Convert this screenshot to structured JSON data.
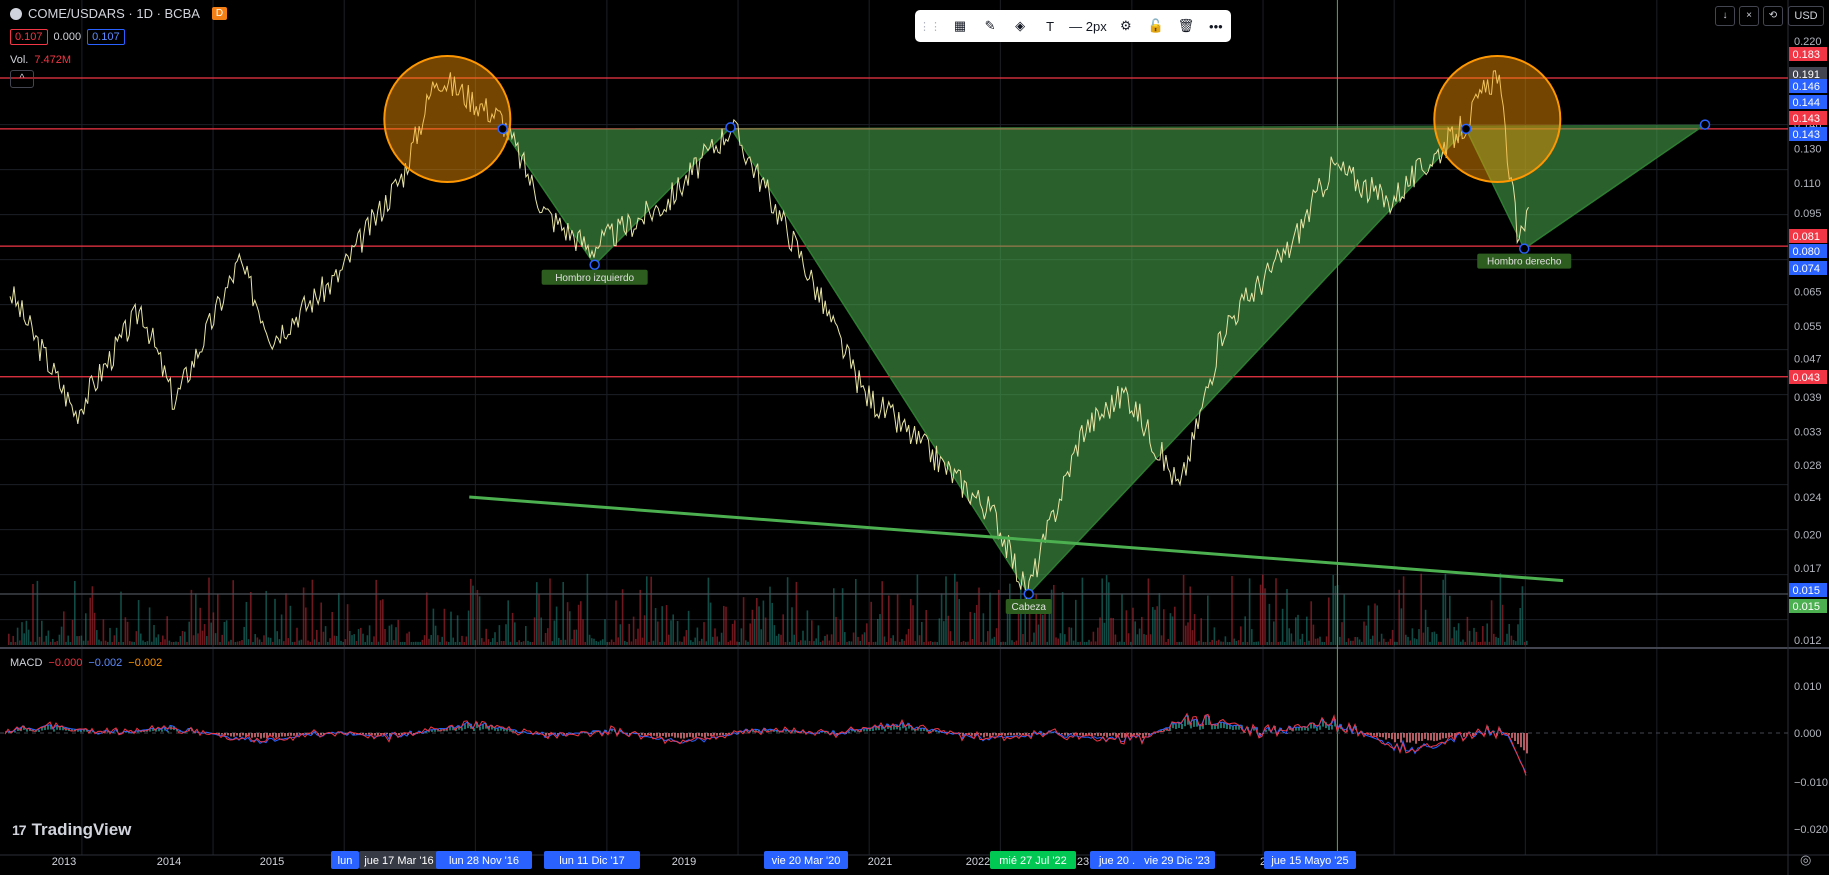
{
  "header": {
    "symbol": "COME/USDARS · 1D · BCBA",
    "badge": "D",
    "open_value": "0.107",
    "change_value": "0.000",
    "close_value": "0.107",
    "volume_label": "Vol.",
    "volume_value": "7.472M",
    "collapse_glyph": "^"
  },
  "toolbar": {
    "items": [
      {
        "name": "drag-handle-icon",
        "glyph": "⋮⋮"
      },
      {
        "name": "template-icon",
        "glyph": "▦"
      },
      {
        "name": "line-color-icon",
        "glyph": "✎"
      },
      {
        "name": "fill-color-icon",
        "glyph": "◈"
      },
      {
        "name": "text-icon",
        "glyph": "T"
      },
      {
        "name": "line-width-icon",
        "glyph": "— 2px"
      },
      {
        "name": "settings-icon",
        "glyph": "⚙"
      },
      {
        "name": "lock-icon",
        "glyph": "🔓"
      },
      {
        "name": "delete-icon",
        "glyph": "🗑"
      },
      {
        "name": "more-icon",
        "glyph": "•••"
      }
    ]
  },
  "top_right": {
    "buttons": [
      "↓",
      "×",
      "⟲"
    ],
    "currency": "USD"
  },
  "macd": {
    "label": "MACD",
    "v1": "−0.000",
    "v2": "−0.002",
    "v3": "−0.002",
    "axis_ticks": [
      "0.010",
      "0.000",
      "−0.010",
      "−0.020"
    ]
  },
  "brand": {
    "logo": "TradingView",
    "mark": "17"
  },
  "chart_data": {
    "type": "line",
    "price_axis_ticks": [
      "0.220",
      "0.146",
      "0.130",
      "0.110",
      "0.095",
      "0.065",
      "0.055",
      "0.047",
      "0.039",
      "0.033",
      "0.028",
      "0.024",
      "0.020",
      "0.017",
      "0.012"
    ],
    "price_tags": [
      {
        "text": "0.183",
        "color": "#f23645"
      },
      {
        "text": "0.191",
        "color": "#434651"
      },
      {
        "text": "0.146",
        "color": "#2962ff"
      },
      {
        "text": "0.144",
        "color": "#2962ff"
      },
      {
        "text": "0.143",
        "color": "#f23645"
      },
      {
        "text": "0.143",
        "color": "#2962ff"
      },
      {
        "text": "0.081",
        "color": "#f23645"
      },
      {
        "text": "0.080",
        "color": "#2962ff"
      },
      {
        "text": "0.074",
        "color": "#2962ff"
      },
      {
        "text": "0.043",
        "color": "#f23645"
      },
      {
        "text": "0.015",
        "color": "#2962ff"
      },
      {
        "text": "0.015",
        "color": "#4caf50"
      }
    ],
    "horizontal_levels": [
      0.183,
      0.143,
      0.081,
      0.043,
      0.015
    ],
    "time_axis_labels": [
      "2013",
      "2014",
      "2015",
      "2019",
      "2021",
      "2022",
      "23",
      "2"
    ],
    "date_tags": [
      {
        "text": "lun",
        "color": "#2962ff"
      },
      {
        "text": "jue 17 Mar '16",
        "color": "#363a45"
      },
      {
        "text": "lun 28 Nov '16",
        "color": "#2962ff"
      },
      {
        "text": "lun 11 Dic '17",
        "color": "#2962ff"
      },
      {
        "text": "vie 20 Mar '20",
        "color": "#2962ff"
      },
      {
        "text": "mié 27 Jul '22",
        "color": "#00c853"
      },
      {
        "text": "jue 20 .",
        "color": "#2962ff"
      },
      {
        "text": "vie 29 Dic '23",
        "color": "#2962ff"
      },
      {
        "text": "jue 15 Mayo '25",
        "color": "#2962ff"
      }
    ],
    "pattern_labels": [
      "Hombro izquierdo",
      "Cabeza",
      "Hombro derecho"
    ],
    "pattern_points": [
      {
        "date": "2016-03-17",
        "value": 0.143
      },
      {
        "date": "2016-11-28",
        "value": 0.074
      },
      {
        "date": "2017-12-11",
        "value": 0.144
      },
      {
        "date": "2020-03-20",
        "value": 0.015
      },
      {
        "date": "2023-07-20",
        "value": 0.143
      },
      {
        "date": "2023-12-29",
        "value": 0.08
      },
      {
        "date": "2025-05-15",
        "value": 0.146
      }
    ],
    "price_series_approx": [
      {
        "x": "2012-06",
        "y": 0.065
      },
      {
        "x": "2012-12",
        "y": 0.036
      },
      {
        "x": "2013-06",
        "y": 0.06
      },
      {
        "x": "2013-09",
        "y": 0.038
      },
      {
        "x": "2014-03",
        "y": 0.075
      },
      {
        "x": "2014-06",
        "y": 0.052
      },
      {
        "x": "2014-12",
        "y": 0.07
      },
      {
        "x": "2015-06",
        "y": 0.115
      },
      {
        "x": "2015-09",
        "y": 0.185
      },
      {
        "x": "2016-03",
        "y": 0.15
      },
      {
        "x": "2016-07",
        "y": 0.095
      },
      {
        "x": "2016-11",
        "y": 0.08
      },
      {
        "x": "2017-06",
        "y": 0.1
      },
      {
        "x": "2017-12",
        "y": 0.145
      },
      {
        "x": "2018-06",
        "y": 0.08
      },
      {
        "x": "2018-12",
        "y": 0.04
      },
      {
        "x": "2019-06",
        "y": 0.03
      },
      {
        "x": "2019-12",
        "y": 0.022
      },
      {
        "x": "2020-03",
        "y": 0.015
      },
      {
        "x": "2020-08",
        "y": 0.033
      },
      {
        "x": "2020-12",
        "y": 0.04
      },
      {
        "x": "2021-05",
        "y": 0.025
      },
      {
        "x": "2021-09",
        "y": 0.055
      },
      {
        "x": "2022-03",
        "y": 0.08
      },
      {
        "x": "2022-07",
        "y": 0.12
      },
      {
        "x": "2022-12",
        "y": 0.1
      },
      {
        "x": "2023-07",
        "y": 0.145
      },
      {
        "x": "2023-10",
        "y": 0.19
      },
      {
        "x": "2023-12",
        "y": 0.08
      },
      {
        "x": "2024-01",
        "y": 0.107
      }
    ],
    "trendline": [
      {
        "date": "2015-12",
        "value": 0.024
      },
      {
        "date": "2024-04",
        "value": 0.016
      }
    ],
    "vertical_line_date": "2022-07-27",
    "grid": true,
    "colors": {
      "pattern_fill": "#4caf50",
      "circle": "#ff9800",
      "levels": "#f23645",
      "trend": "#4caf50",
      "price": "#e8e6a6"
    }
  }
}
